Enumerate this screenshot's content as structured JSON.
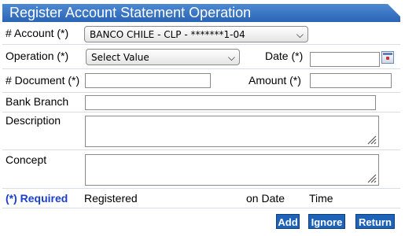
{
  "title": "Register Account Statement Operation",
  "fields": {
    "account_label": "# Account (*)",
    "account_value": "BANCO CHILE - CLP - *******1-04",
    "operation_label": "Operation (*)",
    "operation_value": "Select Value",
    "date_label": "Date (*)",
    "date_value": "",
    "document_label": "# Document (*)",
    "document_value": "",
    "amount_label": "Amount (*)",
    "amount_value": "",
    "branch_label": "Bank Branch",
    "branch_value": "",
    "description_label": "Description",
    "description_value": "",
    "concept_label": "Concept",
    "concept_value": ""
  },
  "footer": {
    "required_note": "(*) Required",
    "registered_label": "Registered",
    "on_date_label": "on Date",
    "time_label": "Time"
  },
  "buttons": {
    "add": "Add",
    "ignore": "Ignore",
    "return": "Return"
  },
  "icons": {
    "chevron": "chevron-down-icon",
    "calendar": "calendar-icon",
    "resize": "resize-grip-icon"
  },
  "colors": {
    "title_bar": "#2f6dbf",
    "button": "#1e63b8",
    "required_text": "#1a3fd0",
    "border": "#8a8a8a"
  }
}
